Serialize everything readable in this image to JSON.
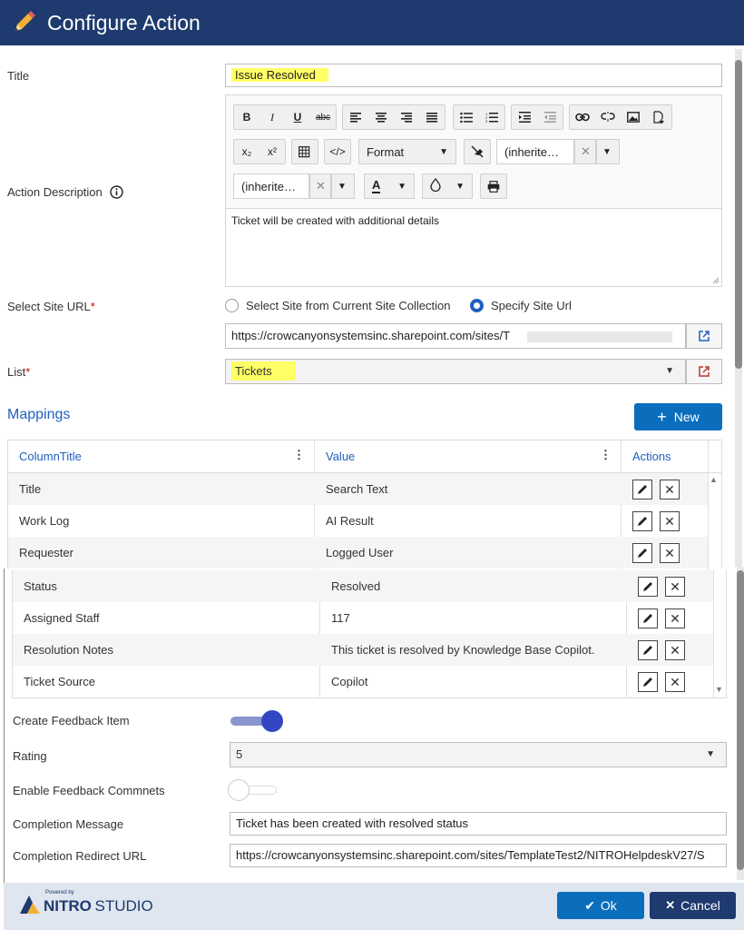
{
  "header": {
    "title": "Configure Action"
  },
  "form": {
    "title_label": "Title",
    "title_value": "Issue Resolved",
    "description_label": "Action Description",
    "description_text": "Ticket will be created with additional details",
    "site_url_label": "Select Site URL",
    "radio_current": "Select Site from Current Site Collection",
    "radio_specify": "Specify Site Url",
    "site_url_value": "https://crowcanyonsystemsinc.sharepoint.com/sites/T",
    "list_label": "List",
    "list_value": "Tickets",
    "required_mark": "*"
  },
  "toolbar": {
    "format_label": "Format",
    "font_name_1": "(inherite…",
    "font_name_2": "(inherite…",
    "bold": "B",
    "italic": "I",
    "underline": "U",
    "strike": "abc",
    "subscript": "x₂",
    "superscript": "x²",
    "code": "</>",
    "font_color": "A"
  },
  "mappings": {
    "title": "Mappings",
    "new_button": "New",
    "columns": [
      "ColumnTitle",
      "Value",
      "Actions"
    ],
    "rows": [
      {
        "column": "Title",
        "value": "Search Text"
      },
      {
        "column": "Work Log",
        "value": "AI Result"
      },
      {
        "column": "Requester",
        "value": "Logged User"
      },
      {
        "column": "Status",
        "value": "Resolved"
      },
      {
        "column": "Assigned Staff",
        "value": "117"
      },
      {
        "column": "Resolution Notes",
        "value": "This ticket is resolved by Knowledge Base Copilot."
      },
      {
        "column": "Ticket Source",
        "value": "Copilot"
      }
    ]
  },
  "feedback": {
    "create_label": "Create Feedback Item",
    "create_on": true,
    "rating_label": "Rating",
    "rating_value": "5",
    "enable_comments_label": "Enable Feedback Commnets",
    "enable_comments_on": false,
    "completion_message_label": "Completion Message",
    "completion_message_value": "Ticket has been created with resolved status",
    "redirect_label": "Completion Redirect URL",
    "redirect_value": "https://crowcanyonsystemsinc.sharepoint.com/sites/TemplateTest2/NITROHelpdeskV27/S"
  },
  "footer": {
    "powered_by": "Powered by",
    "brand_nitro": "NITRO",
    "brand_studio": "STUDIO",
    "ok_label": "Ok",
    "cancel_label": "Cancel"
  },
  "colors": {
    "header": "#1e3a6e",
    "accent": "#1f5fbf",
    "primary_button": "#0a6ebd",
    "highlight": "#ffff66"
  }
}
